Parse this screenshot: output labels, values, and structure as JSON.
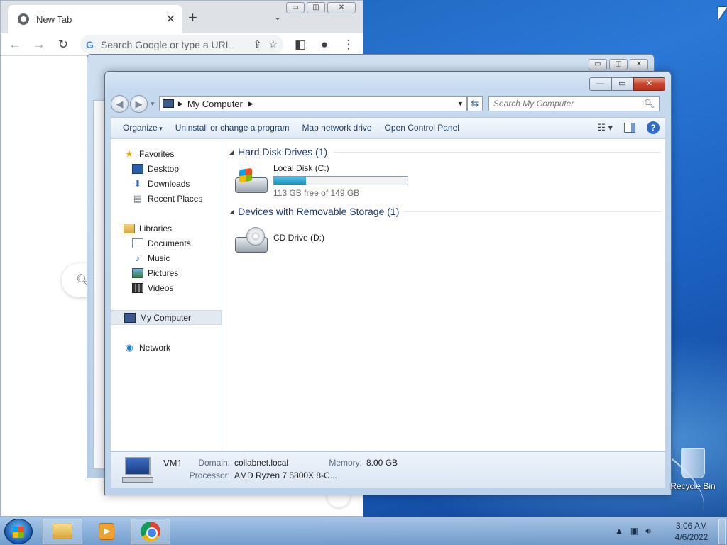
{
  "chrome": {
    "tab_title": "New Tab",
    "tab_close": "✕",
    "new_tab": "+",
    "tab_search": "⌄",
    "omnibox_placeholder": "Search Google or type a URL",
    "g_logo": "G",
    "window_buttons": [
      "▭",
      "◫",
      "✕"
    ]
  },
  "explorer": {
    "window_buttons": {
      "minimize": "—",
      "maximize": "▭",
      "close": "✕"
    },
    "address": {
      "crumb": "My Computer"
    },
    "search_placeholder": "Search My Computer",
    "commands": [
      "Organize",
      "Uninstall or change a program",
      "Map network drive",
      "Open Control Panel"
    ],
    "help": "?",
    "nav": {
      "favorites": "Favorites",
      "desktop": "Desktop",
      "downloads": "Downloads",
      "recent": "Recent Places",
      "libraries": "Libraries",
      "documents": "Documents",
      "music": "Music",
      "pictures": "Pictures",
      "videos": "Videos",
      "my_computer": "My Computer",
      "network": "Network"
    },
    "groups": {
      "hdd_header": "Hard Disk Drives (1)",
      "removable_header": "Devices with Removable Storage (1)"
    },
    "drives": {
      "local_name": "Local Disk (C:)",
      "local_free": "113 GB free of 149 GB",
      "local_used_fraction": 0.24,
      "cd_name": "CD Drive (D:)"
    },
    "details": {
      "name": "VM1",
      "domain_label": "Domain:",
      "domain_value": "collabnet.local",
      "memory_label": "Memory:",
      "memory_value": "8.00 GB",
      "processor_label": "Processor:",
      "processor_value": "AMD Ryzen 7 5800X 8-C..."
    }
  },
  "desktop": {
    "recycle_bin": "Recycle Bin"
  },
  "taskbar": {
    "time": "3:06 AM",
    "date": "4/6/2022"
  }
}
